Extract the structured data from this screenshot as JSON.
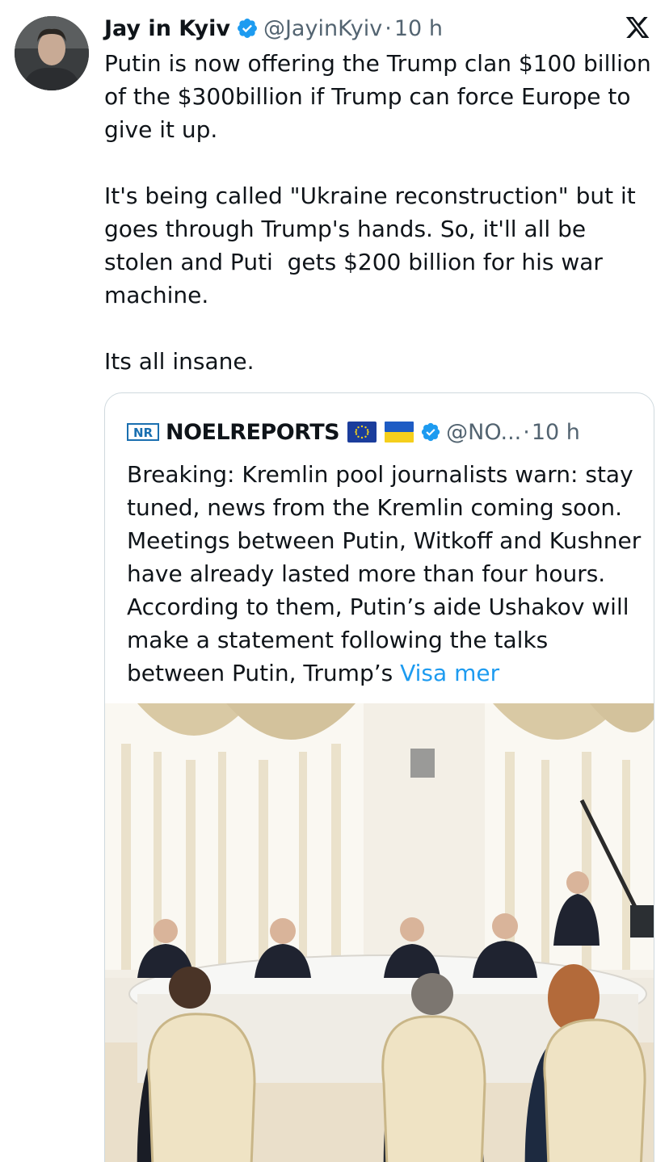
{
  "tweet": {
    "author_name": "Jay in Kyiv",
    "handle": "@JayinKyiv",
    "separator": "·",
    "time": "10 h",
    "paragraphs": [
      "Putin is now offering the Trump clan $100 billion of the $300billion if Trump can force Europe to give it up.",
      "It's being called \"Ukraine reconstruction\" but it goes through Trump's hands. So, it'll all be stolen and Puti  gets $200 billion for his war machine.",
      "Its all insane."
    ]
  },
  "quote": {
    "logo_text": "NR",
    "author_name": "NOELREPORTS",
    "handle": "@NO...",
    "separator": "·",
    "time": "10 h",
    "text": "Breaking: Kremlin pool journalists warn: stay tuned, news from the Kremlin coming soon. Meetings between Putin, Witkoff and Kushner have already lasted more than four hours. According to them, Putin’s aide Ushakov will make a statement following the talks between Putin, Trump’s ",
    "more_label": "Visa mer"
  },
  "icons": {
    "verified": "verified-badge-icon",
    "x_logo": "x-logo-icon",
    "flag_eu": "eu-flag-icon",
    "flag_ua": "ukraine-flag-icon"
  },
  "colors": {
    "verified_blue": "#1d9bf0",
    "text": "#0f1419",
    "secondary_text": "#536471",
    "link": "#1d9bf0",
    "border": "#cfd9de"
  }
}
